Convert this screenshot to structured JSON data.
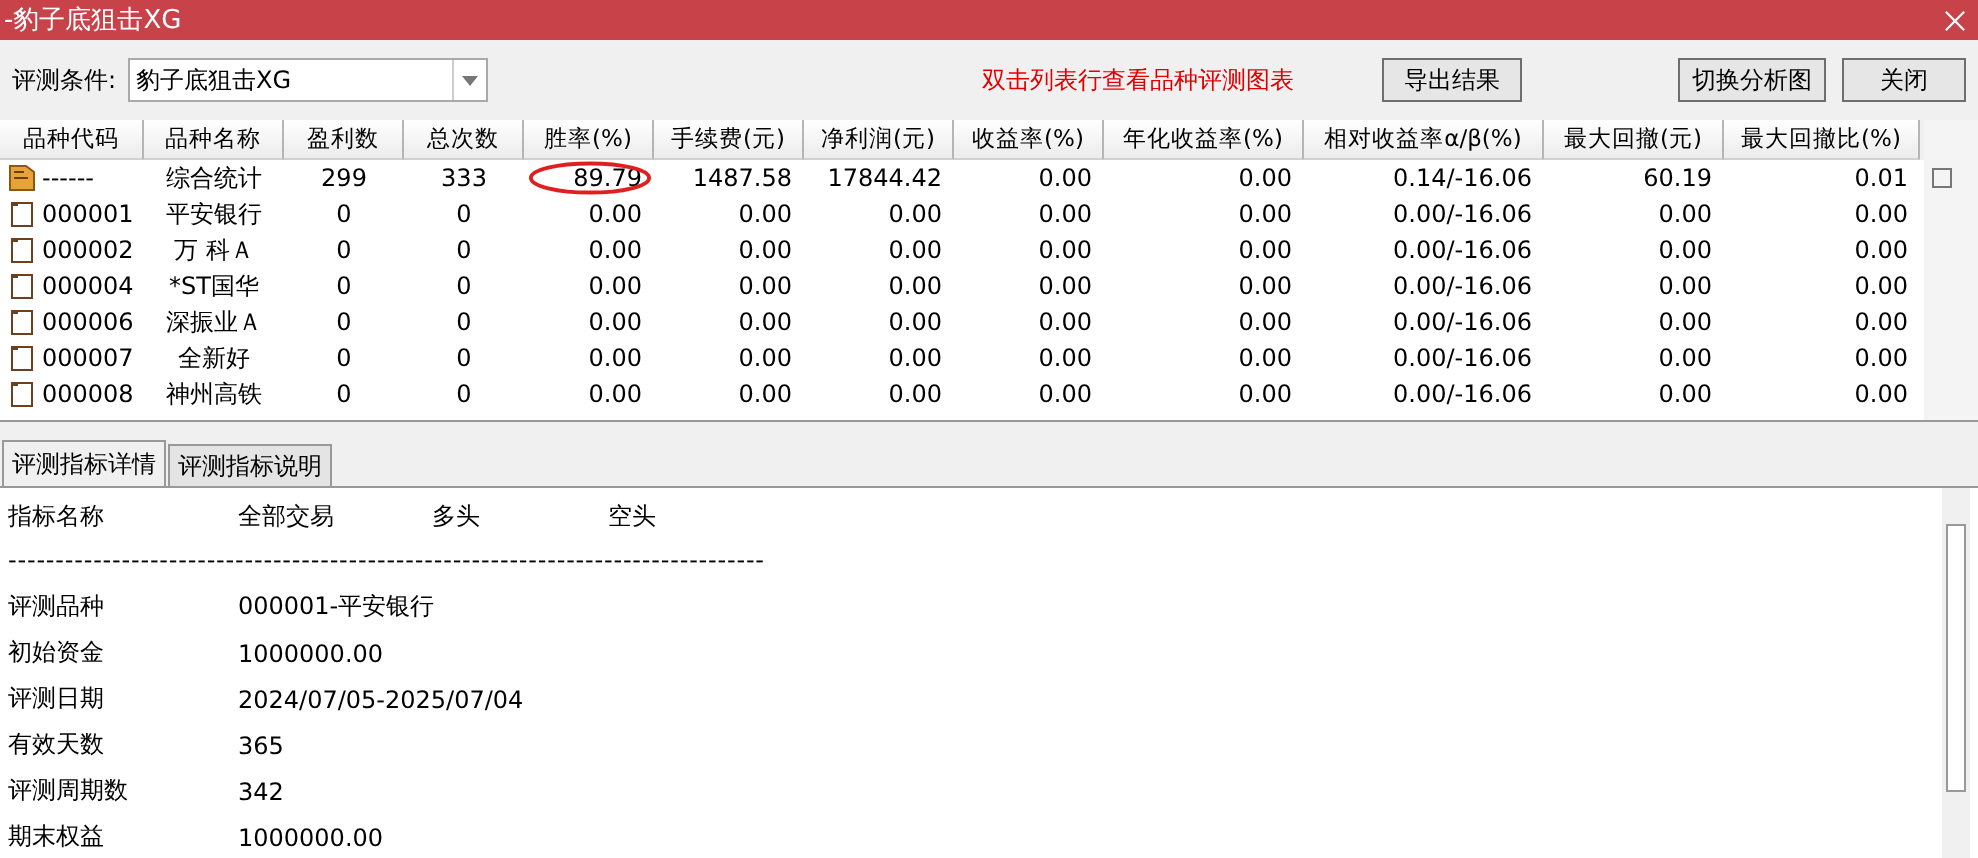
{
  "window": {
    "title": "-豹子底狙击XG"
  },
  "toolbar": {
    "condition_label": "评测条件:",
    "condition_value": "豹子底狙击XG",
    "hint": "双击列表行查看品种评测图表",
    "buttons": [
      "导出结果",
      "切换分析图",
      "关闭"
    ]
  },
  "table": {
    "columns": [
      "品种代码",
      "品种名称",
      "盈利数",
      "总次数",
      "胜率(%)",
      "手续费(元)",
      "净利润(元)",
      "收益率(%)",
      "年化收益率(%)",
      "相对收益率α/β(%)",
      "最大回撤(元)",
      "最大回撤比(%)"
    ],
    "rows": [
      {
        "kind": "summary",
        "circled": true,
        "cells": [
          "------",
          "综合统计",
          "299",
          "333",
          "89.79",
          "1487.58",
          "17844.42",
          "0.00",
          "0.00",
          "0.14/-16.06",
          "60.19",
          "0.01"
        ]
      },
      {
        "kind": "stock",
        "circled": false,
        "cells": [
          "000001",
          "平安银行",
          "0",
          "0",
          "0.00",
          "0.00",
          "0.00",
          "0.00",
          "0.00",
          "0.00/-16.06",
          "0.00",
          "0.00"
        ]
      },
      {
        "kind": "stock",
        "circled": false,
        "cells": [
          "000002",
          "万 科Ａ",
          "0",
          "0",
          "0.00",
          "0.00",
          "0.00",
          "0.00",
          "0.00",
          "0.00/-16.06",
          "0.00",
          "0.00"
        ]
      },
      {
        "kind": "stock",
        "circled": false,
        "cells": [
          "000004",
          "*ST国华",
          "0",
          "0",
          "0.00",
          "0.00",
          "0.00",
          "0.00",
          "0.00",
          "0.00/-16.06",
          "0.00",
          "0.00"
        ]
      },
      {
        "kind": "stock",
        "circled": false,
        "cells": [
          "000006",
          "深振业Ａ",
          "0",
          "0",
          "0.00",
          "0.00",
          "0.00",
          "0.00",
          "0.00",
          "0.00/-16.06",
          "0.00",
          "0.00"
        ]
      },
      {
        "kind": "stock",
        "circled": false,
        "cells": [
          "000007",
          "全新好",
          "0",
          "0",
          "0.00",
          "0.00",
          "0.00",
          "0.00",
          "0.00",
          "0.00/-16.06",
          "0.00",
          "0.00"
        ]
      },
      {
        "kind": "stock",
        "circled": false,
        "cells": [
          "000008",
          "神州高铁",
          "0",
          "0",
          "0.00",
          "0.00",
          "0.00",
          "0.00",
          "0.00",
          "0.00/-16.06",
          "0.00",
          "0.00"
        ]
      }
    ]
  },
  "tabs": [
    {
      "label": "评测指标详情",
      "selected": true
    },
    {
      "label": "评测指标说明",
      "selected": false
    }
  ],
  "details": {
    "headers": [
      "指标名称",
      "全部交易",
      "多头",
      "空头"
    ],
    "separator": "--------------------------------------------------------------------------------",
    "rows": [
      {
        "label": "评测品种",
        "value": "000001-平安银行"
      },
      {
        "label": "初始资金",
        "value": "1000000.00"
      },
      {
        "label": "评测日期",
        "value": "2024/07/05-2025/07/04"
      },
      {
        "label": "有效天数",
        "value": "365"
      },
      {
        "label": "评测周期数",
        "value": " 342"
      },
      {
        "label": "期末权益",
        "value": "1000000.00"
      }
    ]
  }
}
